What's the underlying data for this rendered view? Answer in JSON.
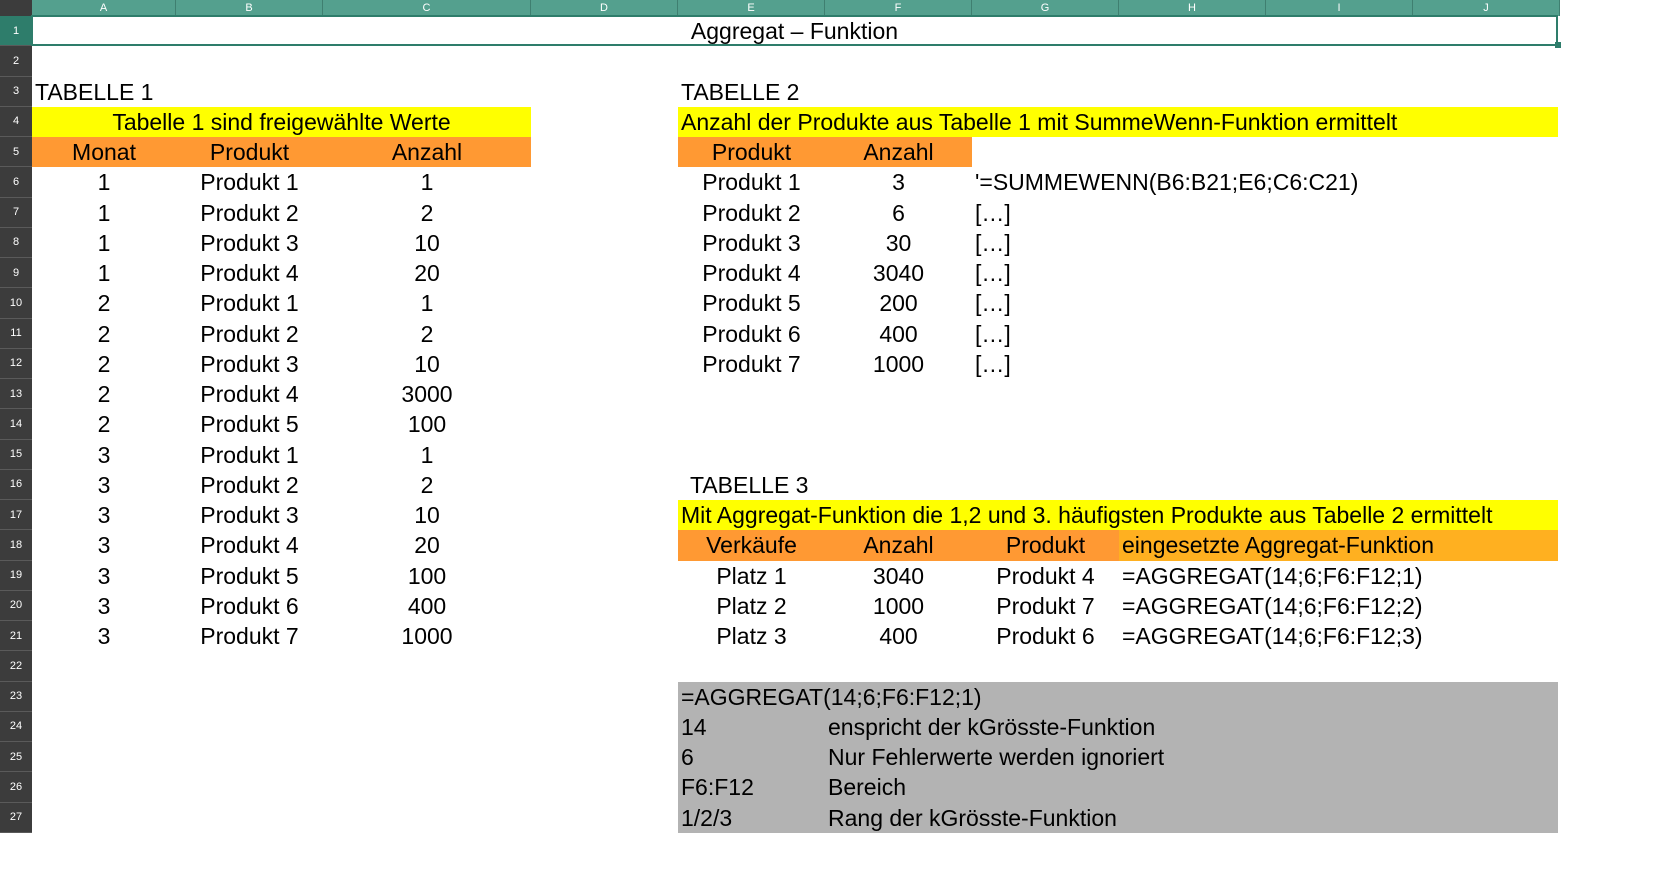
{
  "sheet": {
    "columns": [
      "A",
      "B",
      "C",
      "D",
      "E",
      "F",
      "G",
      "H",
      "I",
      "J"
    ],
    "rows": [
      "1",
      "2",
      "3",
      "4",
      "5",
      "6",
      "7",
      "8",
      "9",
      "10",
      "11",
      "12",
      "13",
      "14",
      "15",
      "16",
      "17",
      "18",
      "19",
      "20",
      "21",
      "22",
      "23",
      "24",
      "25",
      "26",
      "27"
    ],
    "selected_row": "1"
  },
  "title": "Aggregat – Funktion",
  "table1": {
    "heading": "TABELLE 1",
    "caption": "Tabelle 1 sind freigewählte Werte",
    "headers": [
      "Monat",
      "Produkt",
      "Anzahl"
    ],
    "rows": [
      [
        "1",
        "Produkt 1",
        "1"
      ],
      [
        "1",
        "Produkt 2",
        "2"
      ],
      [
        "1",
        "Produkt 3",
        "10"
      ],
      [
        "1",
        "Produkt 4",
        "20"
      ],
      [
        "2",
        "Produkt 1",
        "1"
      ],
      [
        "2",
        "Produkt 2",
        "2"
      ],
      [
        "2",
        "Produkt 3",
        "10"
      ],
      [
        "2",
        "Produkt 4",
        "3000"
      ],
      [
        "2",
        "Produkt 5",
        "100"
      ],
      [
        "3",
        "Produkt 1",
        "1"
      ],
      [
        "3",
        "Produkt 2",
        "2"
      ],
      [
        "3",
        "Produkt 3",
        "10"
      ],
      [
        "3",
        "Produkt 4",
        "20"
      ],
      [
        "3",
        "Produkt 5",
        "100"
      ],
      [
        "3",
        "Produkt 6",
        "400"
      ],
      [
        "3",
        "Produkt 7",
        "1000"
      ]
    ]
  },
  "table2": {
    "heading": "TABELLE 2",
    "caption": "Anzahl der Produkte aus Tabelle 1 mit SummeWenn-Funktion ermittelt",
    "headers": [
      "Produkt",
      "Anzahl"
    ],
    "rows": [
      [
        "Produkt 1",
        "3",
        "'=SUMMEWENN(B6:B21;E6;C6:C21)"
      ],
      [
        "Produkt 2",
        "6",
        "[…]"
      ],
      [
        "Produkt 3",
        "30",
        "[…]"
      ],
      [
        "Produkt 4",
        "3040",
        "[…]"
      ],
      [
        "Produkt 5",
        "200",
        "[…]"
      ],
      [
        "Produkt 6",
        "400",
        "[…]"
      ],
      [
        "Produkt 7",
        "1000",
        "[…]"
      ]
    ]
  },
  "table3": {
    "heading": "TABELLE 3",
    "caption": "Mit Aggregat-Funktion die 1,2 und 3. häufigsten Produkte aus Tabelle 2 ermittelt",
    "headers": [
      "Verkäufe",
      "Anzahl",
      "Produkt",
      "eingesetzte Aggregat-Funktion"
    ],
    "rows": [
      [
        "Platz 1",
        "3040",
        "Produkt 4",
        "=AGGREGAT(14;6;F6:F12;1)"
      ],
      [
        "Platz 2",
        "1000",
        "Produkt 7",
        "=AGGREGAT(14;6;F6:F12;2)"
      ],
      [
        "Platz 3",
        "400",
        "Produkt 6",
        "=AGGREGAT(14;6;F6:F12;3)"
      ]
    ]
  },
  "legend": {
    "formula": "=AGGREGAT(14;6;F6:F12;1)",
    "items": [
      [
        "14",
        "enspricht der kGrösste-Funktion"
      ],
      [
        "6",
        "Nur Fehlerwerte werden ignoriert"
      ],
      [
        "F6:F12",
        "Bereich"
      ],
      [
        "1/2/3",
        "Rang der kGrösste-Funktion"
      ]
    ]
  },
  "colors": {
    "header_green": "#54a08e",
    "row_header_dark": "#3c3c3c",
    "caption_yellow": "#ffff00",
    "header_orange": "#ff9933",
    "header_orange_alt": "#ffb020",
    "legend_grey": "#b3b3b3"
  }
}
